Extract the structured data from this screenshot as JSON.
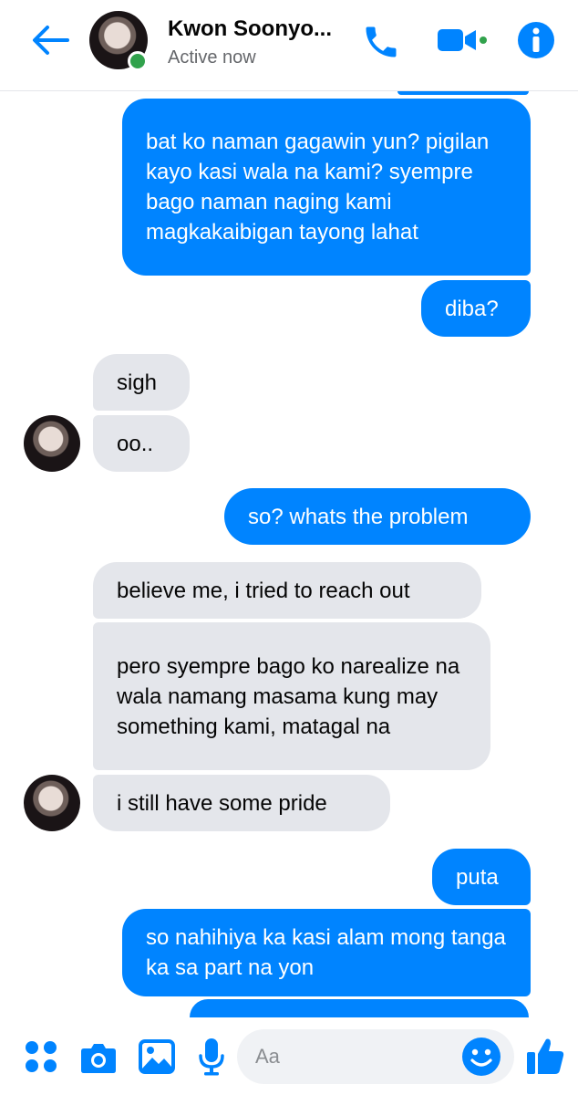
{
  "header": {
    "contact_name": "Kwon Soonyo...",
    "status": "Active now",
    "icons": [
      "back-arrow-icon",
      "phone-icon",
      "video-camera-icon",
      "info-icon"
    ]
  },
  "messages": [
    {
      "direction": "outgoing",
      "text": "bat ko naman gagawin yun? pigilan kayo kasi wala na kami? syempre bago naman naging kami magkakaibigan tayong lahat"
    },
    {
      "direction": "outgoing",
      "text": "diba?"
    },
    {
      "direction": "incoming",
      "text": "sigh"
    },
    {
      "direction": "incoming",
      "text": "oo.."
    },
    {
      "direction": "outgoing",
      "text": "so? whats the problem"
    },
    {
      "direction": "incoming",
      "text": "believe me, i tried to reach out"
    },
    {
      "direction": "incoming",
      "text": "pero syempre bago ko narealize na wala namang masama kung may something kami, matagal na"
    },
    {
      "direction": "incoming",
      "text": "i still have some pride"
    },
    {
      "direction": "outgoing",
      "text": "puta"
    },
    {
      "direction": "outgoing",
      "text": "so nahihiya ka kasi alam mong tanga ka sa part na yon"
    }
  ],
  "composer": {
    "placeholder": "Aa",
    "icons": [
      "apps-dots-icon",
      "camera-icon",
      "photo-gallery-icon",
      "microphone-icon",
      "emoji-icon",
      "thumbs-up-icon"
    ]
  },
  "colors": {
    "accent": "#0084ff",
    "incoming_bubble": "#e4e6eb",
    "online": "#31a24c"
  }
}
